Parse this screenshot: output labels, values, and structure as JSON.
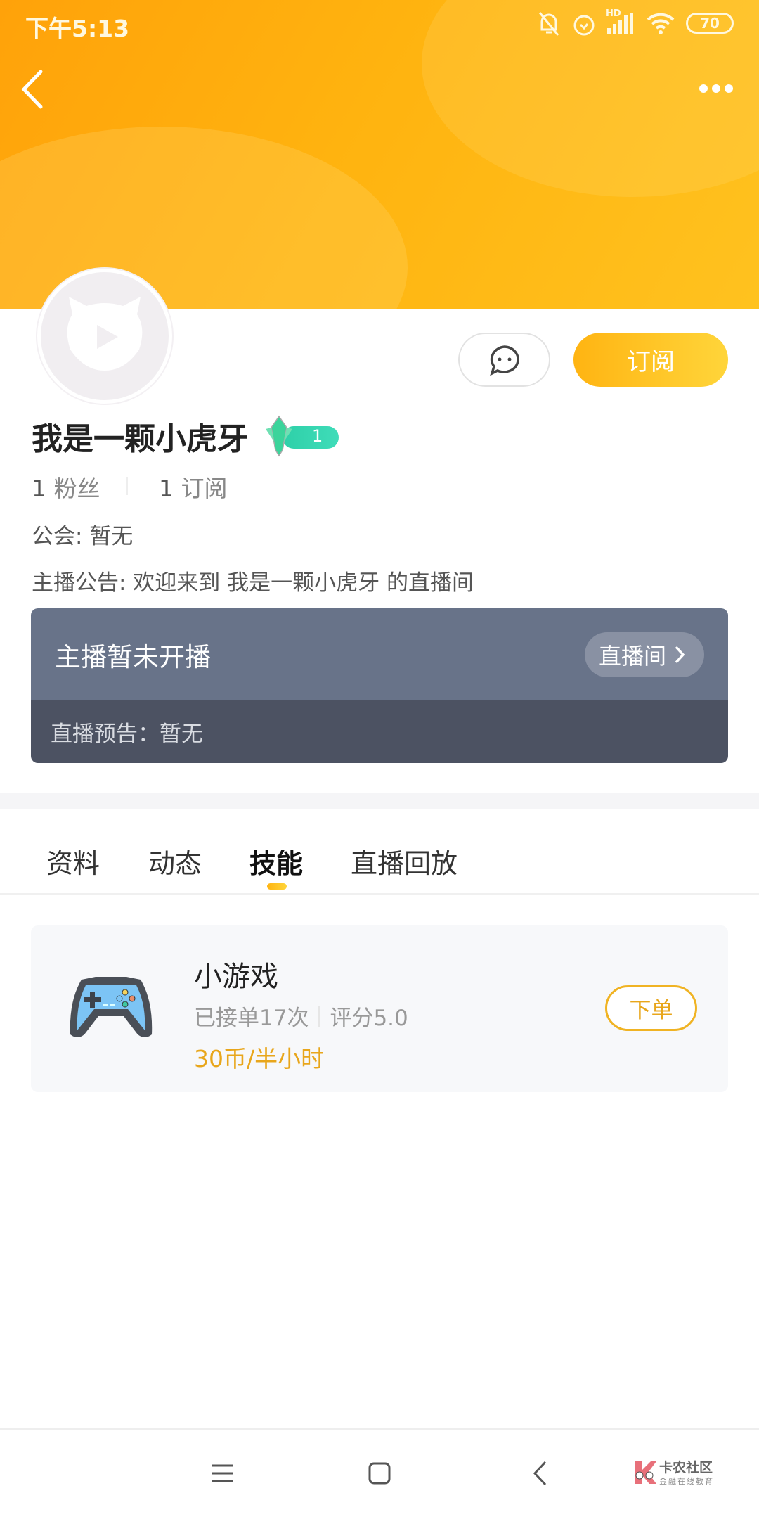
{
  "status_bar": {
    "time": "下午5:13",
    "battery": "70",
    "network": "HD"
  },
  "header": {
    "back_icon": "chevron-left-icon",
    "more_icon": "more-dots-icon"
  },
  "profile": {
    "name": "我是一颗小虎牙",
    "level": "1",
    "fans_count": "1",
    "fans_label": "粉丝",
    "subscribe_count": "1",
    "subscribe_label": "订阅",
    "guild": "公会: 暂无",
    "announcement": "主播公告: 欢迎来到 我是一颗小虎牙 的直播间",
    "subscribe_button": "订阅"
  },
  "live": {
    "status": "主播暂未开播",
    "room_button": "直播间",
    "preview": "直播预告：暂无"
  },
  "tabs": [
    {
      "label": "资料"
    },
    {
      "label": "动态"
    },
    {
      "label": "技能",
      "active": true
    },
    {
      "label": "直播回放"
    }
  ],
  "skill": {
    "title": "小游戏",
    "orders": "已接单17次",
    "rating": "评分5.0",
    "price": "30币/半小时",
    "order_button": "下单"
  },
  "watermark": {
    "title": "卡农社区",
    "subtitle": "金融在线教育"
  },
  "colors": {
    "accent": "#ffb412",
    "price": "#e8a61b",
    "live_card": "#687389"
  }
}
